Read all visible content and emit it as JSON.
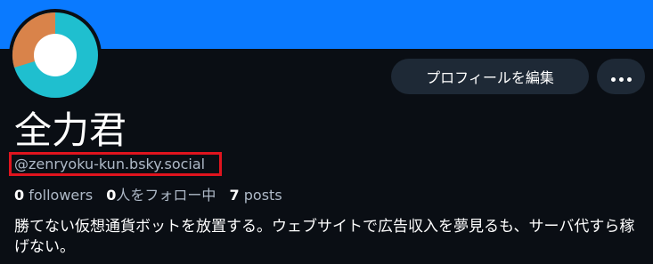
{
  "profile": {
    "display_name": "全力君",
    "handle": "@zenryoku-kun.bsky.social",
    "bio": "勝てない仮想通貨ボットを放置する。ウェブサイトで広告収入を夢見るも、サーバ代すら稼げない。",
    "stats": {
      "followers_count": "0",
      "followers_label": "followers",
      "following_count": "0",
      "following_label": "人をフォロー中",
      "posts_count": "7",
      "posts_label": "posts"
    },
    "avatar": {
      "icon": "donut-chart-avatar",
      "colors": {
        "teal": "#1fbfcf",
        "orange": "#d9834a",
        "center": "#ffffff"
      }
    }
  },
  "actions": {
    "edit_profile_label": "プロフィールを編集",
    "more_icon": "ellipsis-icon"
  },
  "theme": {
    "banner": "#0a7aff",
    "background": "#0a0e14",
    "button_bg": "#1e2936",
    "highlight": "#e0141e"
  }
}
